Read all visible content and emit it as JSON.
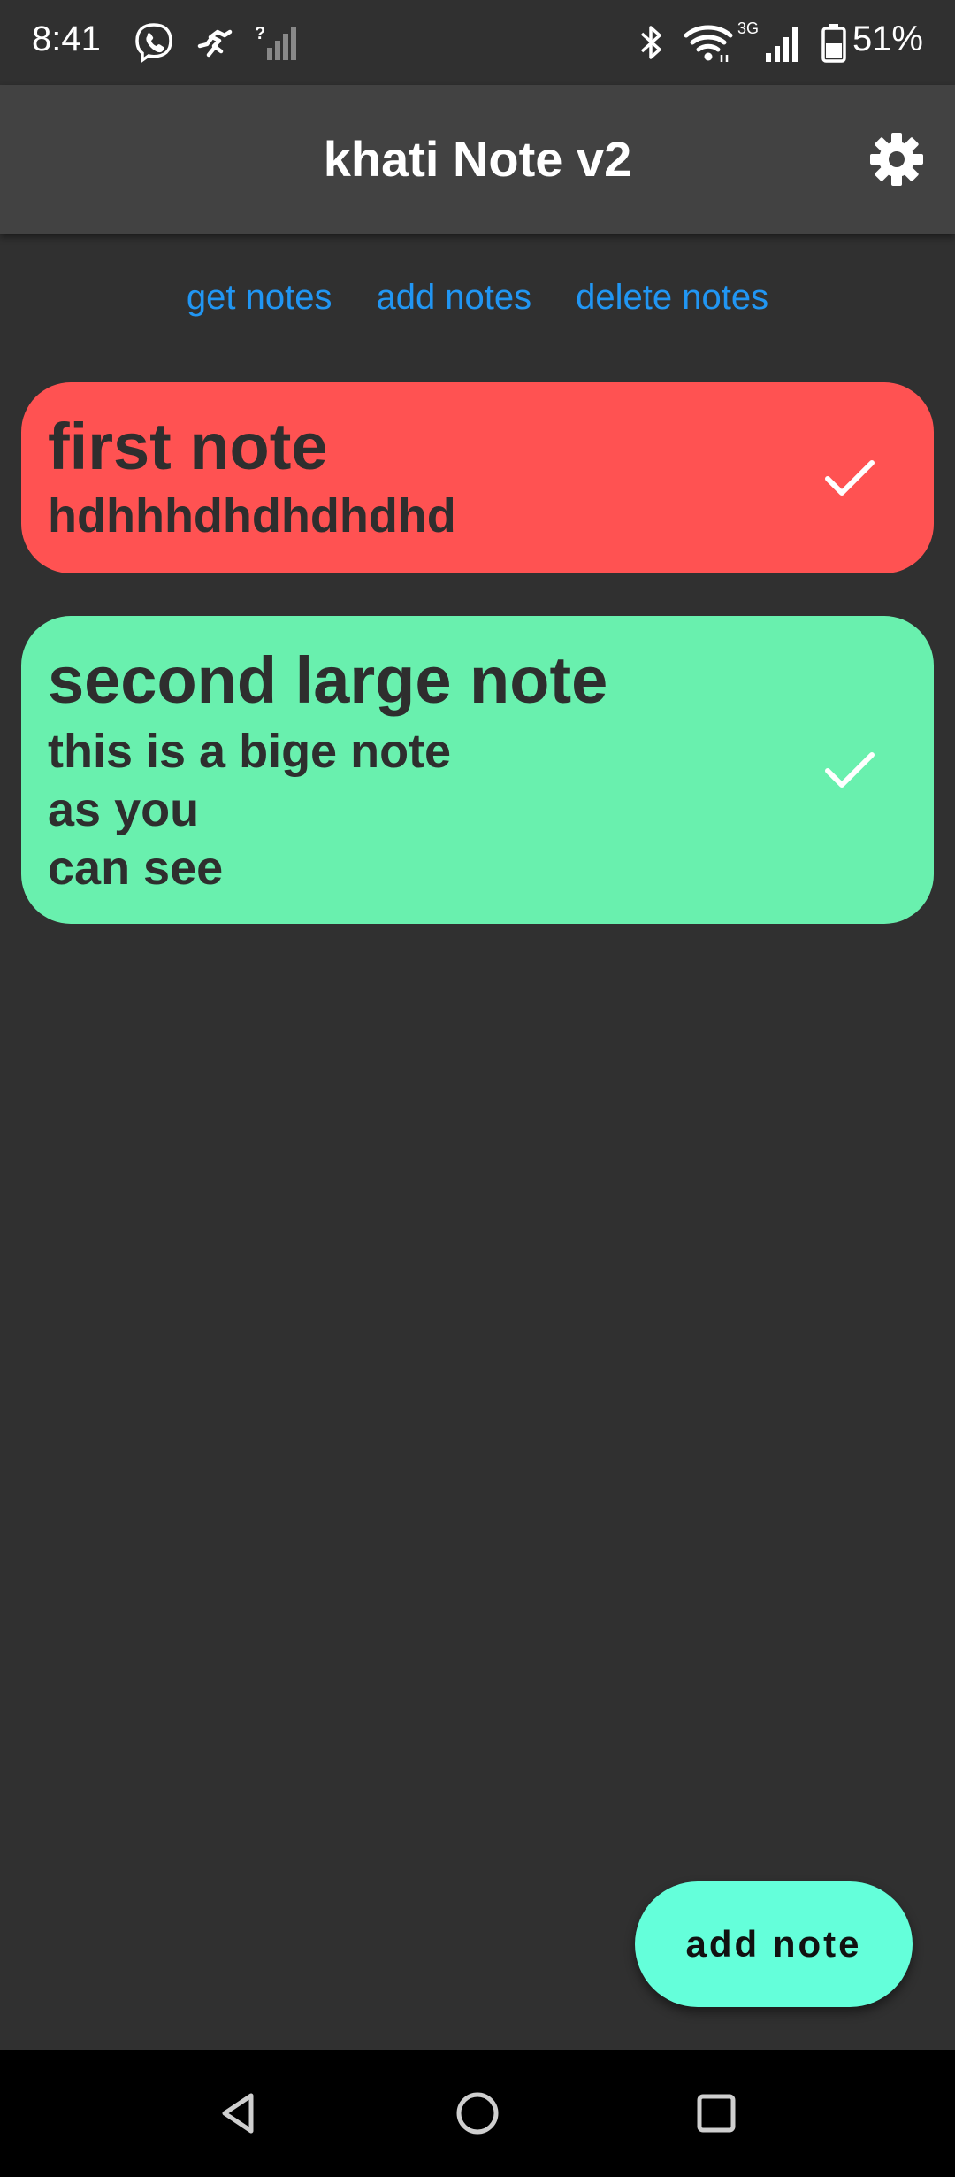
{
  "status_bar": {
    "time": "8:41",
    "icons_left": [
      "viber-icon",
      "running-activity-icon",
      "no-sim-signal-icon"
    ],
    "icons_right": [
      "bluetooth-icon",
      "wifi-icon",
      "cellular-3g-icon",
      "battery-icon"
    ],
    "network_type": "3G",
    "unknown_signal_mark": "?",
    "battery_percent": "51%"
  },
  "app_bar": {
    "title": "khati Note v2",
    "settings_icon": "gear-icon"
  },
  "actions": {
    "get_notes": "get notes",
    "add_notes": "add notes",
    "delete_notes": "delete notes"
  },
  "notes": [
    {
      "title": "first note",
      "body": "hdhhhdhdhdhdhd",
      "color": "#ff5252",
      "action_icon": "check-icon"
    },
    {
      "title": "second large note",
      "body": "this is a bige note\nas you\ncan see",
      "color": "#69f0ae",
      "action_icon": "check-icon"
    }
  ],
  "fab": {
    "label": "add note",
    "color": "#64ffda"
  },
  "nav_bar": {
    "icons": [
      "back-triangle-icon",
      "home-circle-icon",
      "recents-square-icon"
    ]
  },
  "colors": {
    "background": "#303030",
    "app_bar": "#424242",
    "accent_text": "#2196f3"
  }
}
